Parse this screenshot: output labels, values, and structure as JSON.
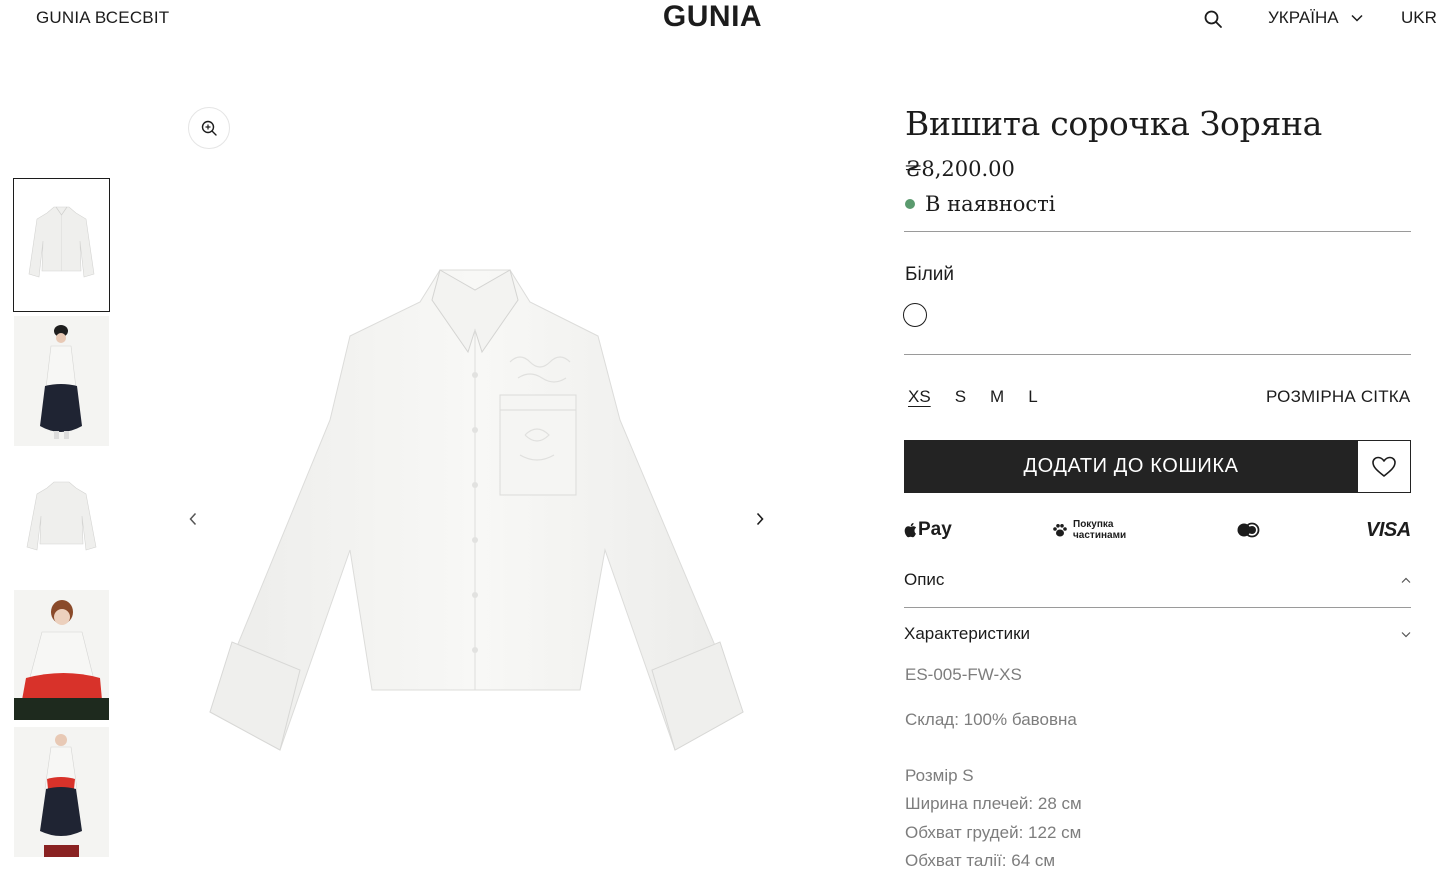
{
  "header": {
    "left_link": "GUNIA ВСЕСВІТ",
    "logo": "GUNIA",
    "country": "УКРАЇНА",
    "language": "UKR",
    "icons": {
      "search": "search-icon",
      "dropdown": "chevron-down-icon"
    }
  },
  "gallery": {
    "thumbnails": [
      {
        "name": "shirt-front-thumbnail",
        "selected": true
      },
      {
        "name": "model-full-thumbnail",
        "selected": false
      },
      {
        "name": "shirt-back-thumbnail",
        "selected": false
      },
      {
        "name": "model-closeup-thumbnail",
        "selected": false
      },
      {
        "name": "model-full-red-thumbnail",
        "selected": false
      }
    ],
    "icons": {
      "zoom": "zoom-in-icon",
      "prev": "chevron-left-icon",
      "next": "chevron-right-icon"
    }
  },
  "product": {
    "title": "Вишита сорочка Зоряна",
    "price": "₴8,200.00",
    "stock": "В наявності",
    "stock_color": "#5a9a6e",
    "color_label": "Білий",
    "sizes": [
      "XS",
      "S",
      "M",
      "L"
    ],
    "selected_size": "XS",
    "size_chart": "РОЗМІРНА СІТКА",
    "add_to_cart": "ДОДАТИ ДО КОШИКА",
    "payment": {
      "apple_pay": "Pay",
      "parts_line1": "Покупка",
      "parts_line2": "частинами",
      "visa": "VISA"
    },
    "accordion": {
      "description": "Опис",
      "characteristics": "Характеристики"
    },
    "specs": {
      "sku": "ES-005-FW-XS",
      "composition": "Склад: 100% бавовна",
      "size_title": "Розмір S",
      "shoulder": "Ширина плечей: 28 см",
      "chest": "Обхват грудей: 122 см",
      "waist": "Обхват талії: 64 см"
    }
  },
  "colors": {
    "button_dark": "#232323",
    "divider": "#9a9a9a",
    "muted_text": "#7d7d7d"
  }
}
